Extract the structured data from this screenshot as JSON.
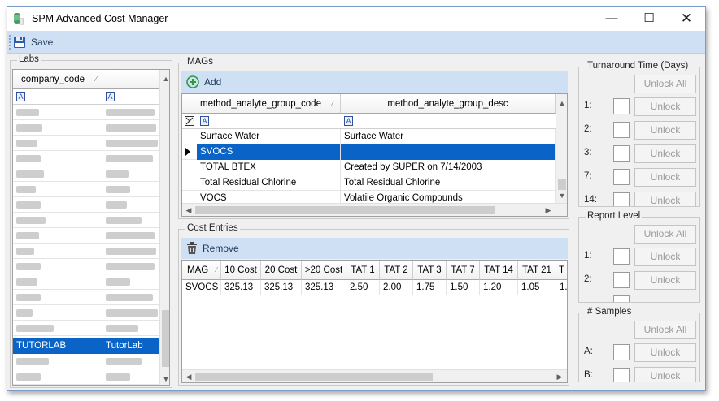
{
  "window": {
    "title": "SPM Advanced Cost Manager",
    "min_glyph": "—",
    "max_glyph": "☐",
    "close_glyph": "✕"
  },
  "toolbar": {
    "save_label": "Save"
  },
  "labs": {
    "title": "Labs",
    "col_company_code": "company_code",
    "filter_icon": "A",
    "selected_row": {
      "code": "TUTORLAB",
      "name": "TutorLab"
    }
  },
  "mags": {
    "title": "MAGs",
    "add_label": "Add",
    "columns": [
      "method_analyte_group_code",
      "method_analyte_group_desc"
    ],
    "filter_icon": "A",
    "rows": [
      {
        "code": "Surface Water",
        "desc": "Surface Water",
        "selected": false
      },
      {
        "code": "SVOCS",
        "desc": "",
        "selected": true
      },
      {
        "code": "TOTAL BTEX",
        "desc": "Created by SUPER on 7/14/2003",
        "selected": false
      },
      {
        "code": "Total Residual Chlorine",
        "desc": "Total Residual Chlorine",
        "selected": false
      },
      {
        "code": "VOCS",
        "desc": "Volatile Organic Compounds",
        "selected": false
      }
    ]
  },
  "cost_entries": {
    "title": "Cost Entries",
    "remove_label": "Remove",
    "columns": [
      "MAG",
      "10 Cost",
      "20 Cost",
      ">20 Cost",
      "TAT 1",
      "TAT 2",
      "TAT 3",
      "TAT 7",
      "TAT 14",
      "TAT 21",
      "T"
    ],
    "rows": [
      [
        "SVOCS",
        "325.13",
        "325.13",
        "325.13",
        "2.50",
        "2.00",
        "1.75",
        "1.50",
        "1.20",
        "1.05",
        "1."
      ]
    ]
  },
  "turnaround": {
    "title": "Turnaround Time (Days)",
    "unlock_all_label": "Unlock All",
    "unlock_label": "Unlock",
    "items": [
      "1:",
      "2:",
      "3:",
      "7:",
      "14:"
    ]
  },
  "report_level": {
    "title": "Report Level",
    "unlock_all_label": "Unlock All",
    "unlock_label": "Unlock",
    "items": [
      "1:",
      "2:"
    ]
  },
  "samples": {
    "title": "# Samples",
    "unlock_all_label": "Unlock All",
    "unlock_label": "Unlock",
    "items": [
      "A:",
      "B:"
    ]
  },
  "colors": {
    "accent": "#0a64c8",
    "toolbar": "#cfe0f5",
    "add_green": "#2e9a3c"
  }
}
